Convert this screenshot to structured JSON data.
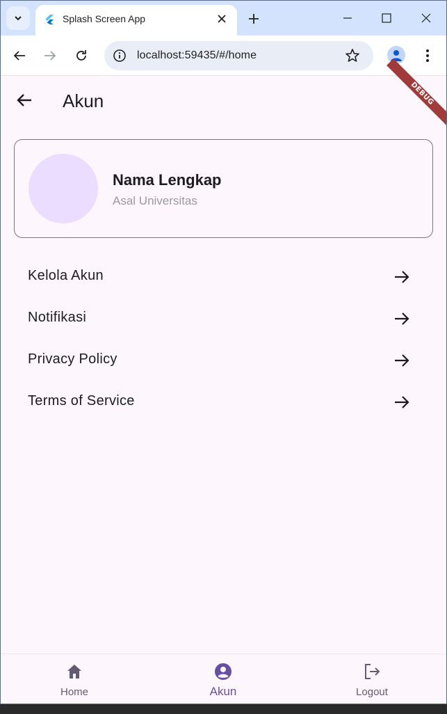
{
  "browser": {
    "tab_title": "Splash Screen App",
    "url": "localhost:59435/#/home"
  },
  "app": {
    "debug_label": "DEBUG",
    "page_title": "Akun",
    "profile": {
      "name": "Nama Lengkap",
      "university": "Asal Universitas"
    },
    "menu_items": [
      {
        "label": "Kelola Akun",
        "icon": "arrow-forward-icon"
      },
      {
        "label": "Notifikasi",
        "icon": "arrow-forward-icon"
      },
      {
        "label": "Privacy Policy",
        "icon": "arrow-forward-icon"
      },
      {
        "label": "Terms of Service",
        "icon": "arrow-forward-icon"
      }
    ],
    "bottom_nav": [
      {
        "label": "Home",
        "icon": "home-icon",
        "active": false
      },
      {
        "label": "Akun",
        "icon": "account-circle-icon",
        "active": true
      },
      {
        "label": "Logout",
        "icon": "logout-icon",
        "active": false
      }
    ]
  },
  "colors": {
    "background": "#fdf7fd",
    "accent": "#6750a4",
    "avatar": "#eaddff",
    "debug_banner": "#a33a3a",
    "tabstrip": "#d3e3fd"
  }
}
